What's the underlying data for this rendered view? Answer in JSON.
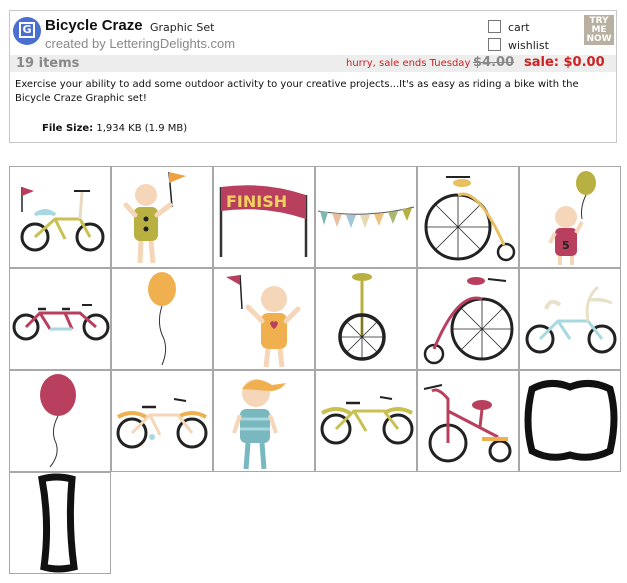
{
  "header": {
    "title": "Bicycle Craze",
    "subtitle": "Graphic Set",
    "creator": "created by LetteringDelights.com",
    "logo_letter": "G",
    "cart_label": "cart",
    "wishlist_label": "wishlist",
    "try_me_now": "TRY ME NOW"
  },
  "bar": {
    "items_count": "19 items",
    "hurry_text": "hurry, sale ends Tuesday",
    "old_price": "$4.00",
    "sale_price": "sale: $0.00"
  },
  "description": "Exercise your ability to add some outdoor activity to your creative projects...It's as easy as riding a bike with the Bicycle Craze Graphic set!",
  "file_size": {
    "label": "File Size:",
    "value": "1,934 KB (1.9 MB)"
  },
  "colors": {
    "brand_blue": "#4a6fd0",
    "sale_red": "#cc2222",
    "muted_gray": "#888888"
  },
  "gallery": [
    {
      "icon": "bicycle-flag-icon"
    },
    {
      "icon": "person-flag-icon"
    },
    {
      "icon": "finish-banner-icon",
      "text": "FINISH"
    },
    {
      "icon": "pennant-bunting-icon"
    },
    {
      "icon": "penny-farthing-icon"
    },
    {
      "icon": "person-balloon-icon",
      "text": "5"
    },
    {
      "icon": "tandem-bicycle-icon"
    },
    {
      "icon": "orange-balloon-icon"
    },
    {
      "icon": "person-heart-flag-icon"
    },
    {
      "icon": "unicycle-icon"
    },
    {
      "icon": "pink-penny-farthing-icon"
    },
    {
      "icon": "cruiser-bicycle-icon"
    },
    {
      "icon": "red-balloon-icon"
    },
    {
      "icon": "orange-bicycle-icon"
    },
    {
      "icon": "boy-cap-icon"
    },
    {
      "icon": "yellow-bicycle-icon"
    },
    {
      "icon": "tricycle-icon"
    },
    {
      "icon": "black-frame-icon"
    },
    {
      "icon": "tall-frame-icon"
    }
  ]
}
